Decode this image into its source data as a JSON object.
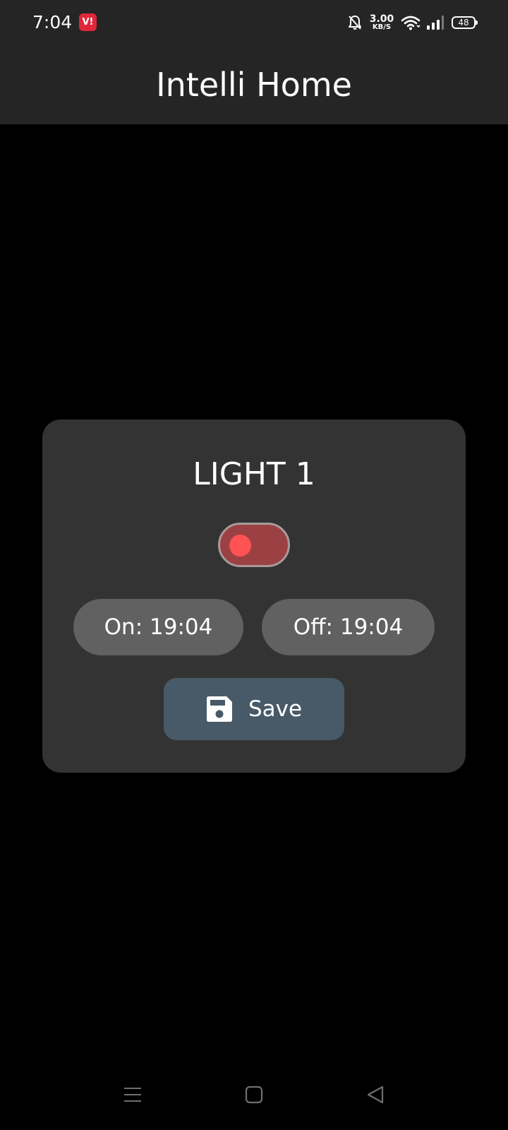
{
  "status_bar": {
    "time": "7:04",
    "carrier_badge": "V!",
    "net_speed_value": "3.00",
    "net_speed_unit": "KB/S",
    "battery_level": "48",
    "icons": [
      "carrier-icon",
      "bell-off-icon",
      "wifi-icon",
      "signal-icon",
      "battery-icon"
    ]
  },
  "app_bar": {
    "title": "Intelli Home"
  },
  "device_card": {
    "name": "LIGHT 1",
    "toggle_on": false,
    "on_time_label": "On: 19:04",
    "off_time_label": "Off: 19:04",
    "save_label": "Save",
    "save_icon": "floppy-disk-icon"
  },
  "nav_bar": {
    "icons": [
      "menu-icon",
      "home-square-icon",
      "back-triangle-icon"
    ]
  },
  "colors": {
    "background": "#000000",
    "bar": "#252525",
    "card": "#333333",
    "toggle_track": "#9c4143",
    "toggle_thumb": "#ff5252",
    "pill": "#616161",
    "save_button": "#485a67",
    "carrier_badge": "#e0263a"
  }
}
